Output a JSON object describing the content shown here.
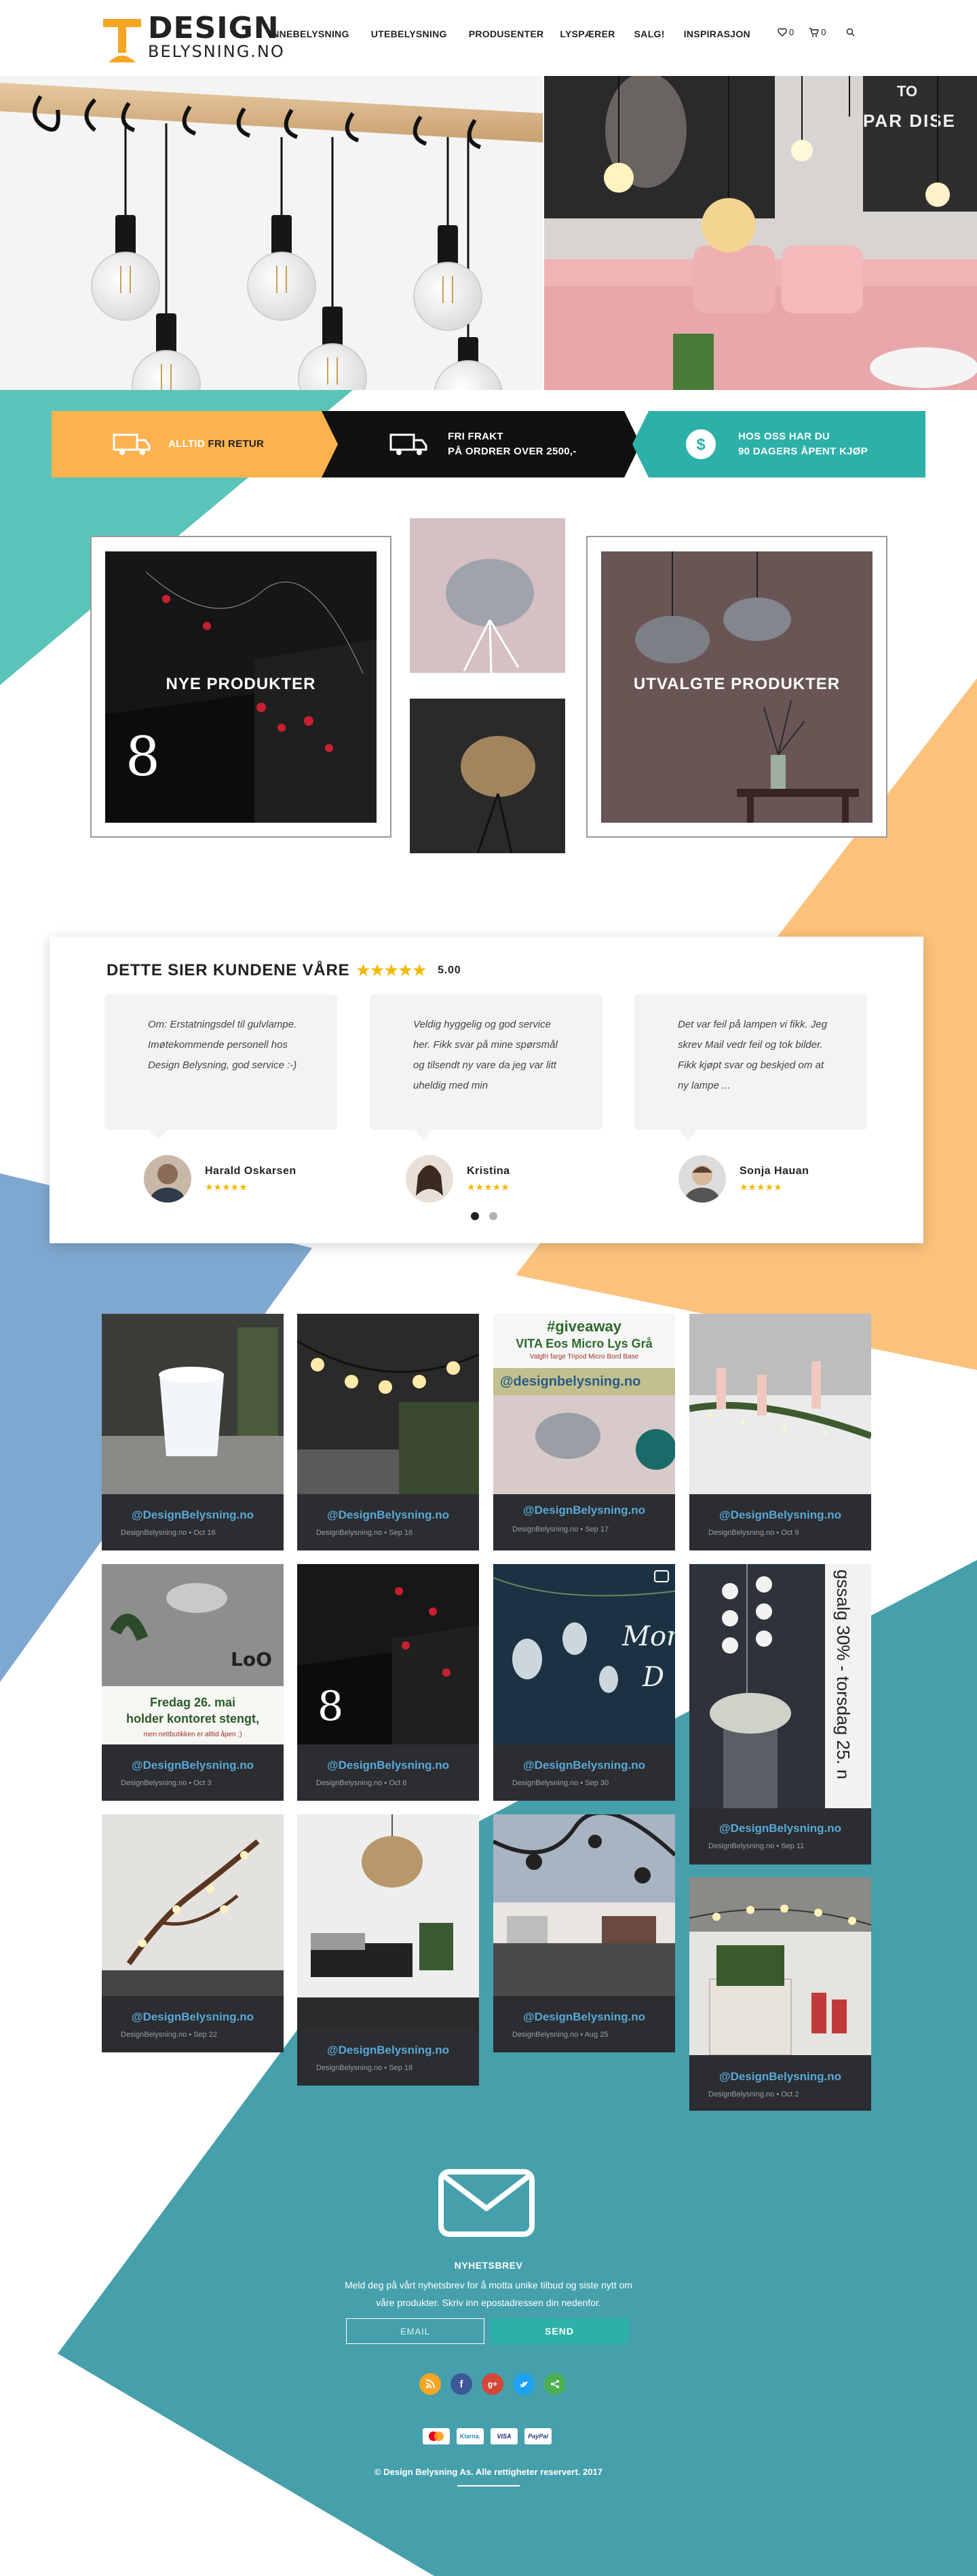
{
  "header": {
    "logo_line1": "DESIGN",
    "logo_line2": "BELYSNING.NO",
    "nav": [
      "INNEBELYSNING",
      "UTEBELYSNING",
      "PRODUSENTER",
      "LYSPÆRER",
      "SALG!",
      "INSPIRASJON"
    ],
    "wishlist_count": "0",
    "cart_count": "0"
  },
  "hero_right": {
    "poster_text_1": "TO",
    "poster_text_2": "PAR DISE"
  },
  "banner": {
    "item1_prefix": "ALLTID",
    "item1_main": "FRI RETUR",
    "item2_line1": "FRI FRAKT",
    "item2_line2": "PÅ ORDRER OVER 2500,-",
    "item3_line1": "HOS OSS HAR DU",
    "item3_line2": "90 DAGERS ÅPENT KJØP"
  },
  "products": {
    "new_label": "NYE PRODUKTER",
    "selected_label": "UTVALGTE PRODUKTER"
  },
  "reviews": {
    "title": "DETTE SIER KUNDENE VÅRE",
    "stars": "★★★★★",
    "score": "5.00",
    "items": [
      {
        "text": "Om: Erstatningsdel til gulvlampe. Imøtekommende personell hos Design Belysning, god service :-)",
        "name": "Harald Oskarsen",
        "stars": "★★★★★"
      },
      {
        "text": "Veldig hyggelig og god service her. Fikk svar på mine spørsmål og tilsendt ny vare da jeg var litt uheldig med min",
        "name": "Kristina",
        "stars": "★★★★★"
      },
      {
        "text": "Det var feil på lampen vi fikk. Jeg skrev Mail vedr feil og tok bilder. Fikk kjøpt svar og beskjed om at ny lampe ...",
        "name": "Sonja Hauan",
        "stars": "★★★★★"
      }
    ]
  },
  "instagram": {
    "handle": "@DesignBelysning.no",
    "source": "DesignBelysning.no",
    "posts": [
      {
        "date": "Oct 16"
      },
      {
        "date": "Sep 16"
      },
      {
        "date": "Sep 17",
        "overlay1": "#giveaway",
        "overlay2": "VITA Eos Micro Lys Grå",
        "overlay3": "Valgfri farge Tripod Micro Bord Base",
        "overlay4": "@designbelysning.no"
      },
      {
        "date": "Oct 9"
      },
      {
        "date": "Oct 3",
        "overlay1": "Fredag 26. mai",
        "overlay2": "holder kontoret stengt,",
        "overlay3": "men nettbutikken er alltid åpen ;)",
        "overlay4": "LoO"
      },
      {
        "date": "Oct 6"
      },
      {
        "date": "Sep 30",
        "overlay1": "Morn",
        "overlay2": "D"
      },
      {
        "date": "Sep 11",
        "overlay1": "gssalg 30% - torsdag 25. n"
      },
      {
        "date": "Sep 22"
      },
      {
        "date": "Sep 18"
      },
      {
        "date": "Aug 25"
      },
      {
        "date": "Oct 2"
      }
    ]
  },
  "newsletter": {
    "title": "NYHETSBREV",
    "description": "Meld deg på vårt nyhetsbrev for å motta unike tilbud og siste nytt om våre produkter. Skriv inn epostadressen din nedenfor.",
    "placeholder": "EMAIL",
    "send_label": "SEND"
  },
  "payments": [
    "VISA-MC",
    "Klarna.",
    "VISA",
    "PayPal"
  ],
  "copyright": "© Design Belysning As. Alle rettigheter reservert. 2017",
  "colors": {
    "teal": "#5bc4b8",
    "orange": "#fcc27c",
    "blue": "#7fa8d0",
    "dark_teal": "#45a0ac",
    "banner_orange": "#fbb24f",
    "banner_teal": "#2db0a8",
    "star": "#f5b800"
  }
}
